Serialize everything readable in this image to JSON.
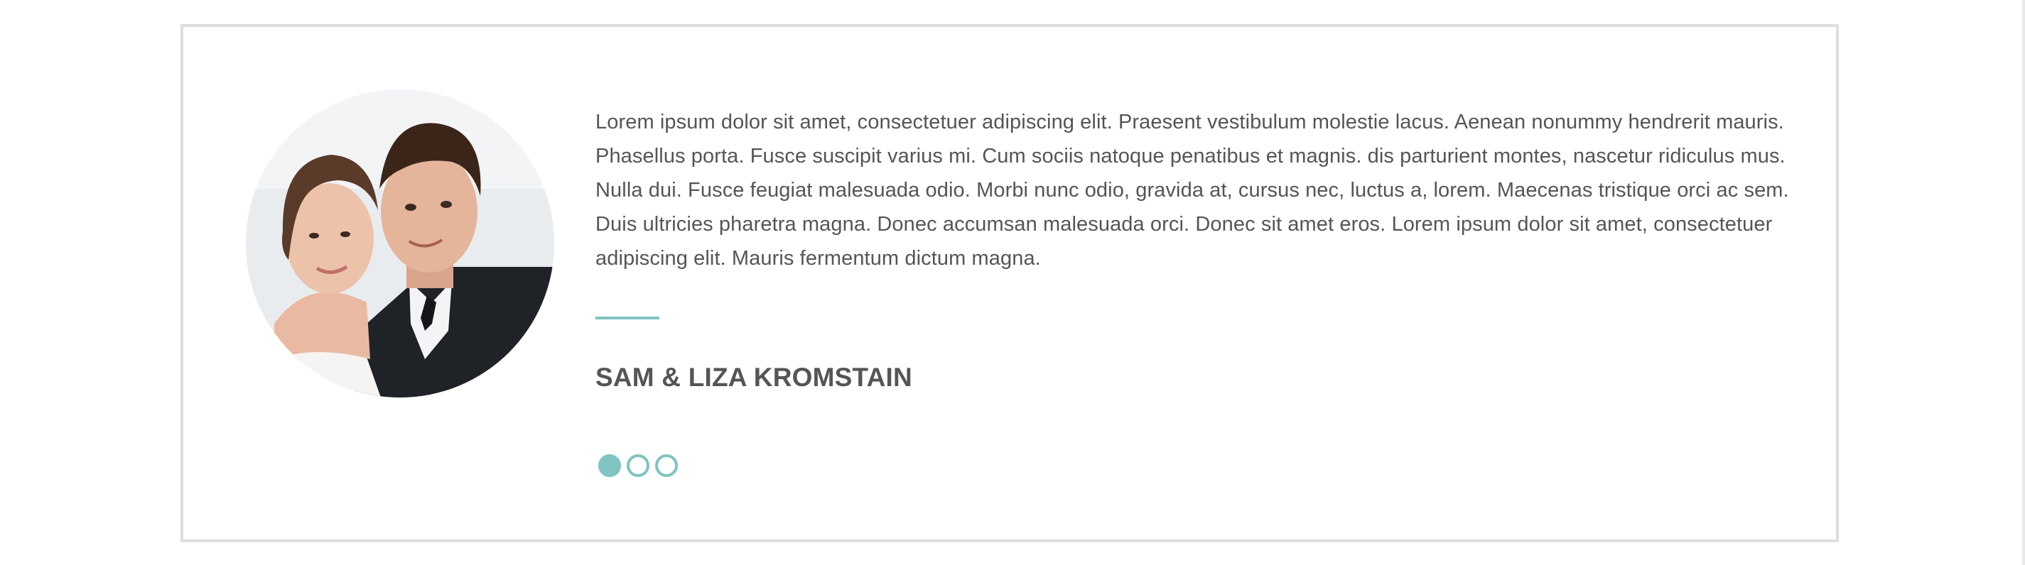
{
  "testimonial": {
    "quote": "Lorem ipsum dolor sit amet, consectetuer adipiscing elit. Praesent vestibulum molestie lacus. Aenean nonummy hendrerit mauris. Phasellus porta. Fusce suscipit varius mi. Cum sociis natoque penatibus et magnis. dis parturient montes, nascetur ridiculus mus. Nulla dui. Fusce feugiat malesuada odio. Morbi nunc odio, gravida at, cursus nec, luctus a, lorem. Maecenas tristique orci ac sem. Duis ultricies pharetra magna. Donec accumsan malesuada orci. Donec sit amet eros. Lorem ipsum dolor sit amet, consectetuer adipiscing elit. Mauris fermentum dictum magna.",
    "author": "SAM & LIZA KROMSTAIN",
    "avatar_icon": "couple-photo",
    "pager": {
      "count": 3,
      "active_index": 0
    }
  },
  "colors": {
    "accent": "#7fc4c1",
    "text": "#555555",
    "border": "#dedede"
  }
}
